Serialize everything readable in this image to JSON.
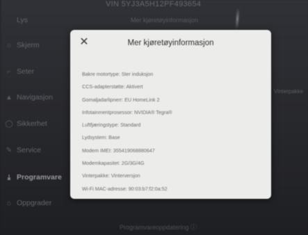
{
  "header": {
    "vin": "VIN 5YJ3A5H12PF493654",
    "subtitle": "Mer kjøretøyinformasjon"
  },
  "sidebar": {
    "items": [
      {
        "label": "Lys",
        "icon": "light-icon",
        "glyph": ""
      },
      {
        "label": "Skjerm",
        "icon": "display-icon",
        "glyph": "☼"
      },
      {
        "label": "Seter",
        "icon": "seat-icon",
        "glyph": "⌐"
      },
      {
        "label": "Navigasjon",
        "icon": "navigation-icon",
        "glyph": "▲"
      },
      {
        "label": "Sikkerhet",
        "icon": "shield-icon",
        "glyph": "◯"
      },
      {
        "label": "Service",
        "icon": "wrench-icon",
        "glyph": "✎"
      },
      {
        "label": "Programvare",
        "icon": "download-icon",
        "glyph": "⤓"
      },
      {
        "label": "Oppgrader",
        "icon": "upgrade-icon",
        "glyph": "⌂"
      }
    ]
  },
  "right_edge": {
    "text1": "Vinterpakke",
    "text2": ""
  },
  "bottom": {
    "text": "Programvareoppdatering ⓘ"
  },
  "dialog": {
    "title": "Mer kjøretøyinformasjon",
    "close_glyph": "✕",
    "rows": [
      "Bakre motortype: Ster induksjon",
      "CCS-adapterstøtte: Aktivert",
      "Gomaljadarlipnerr: EU HomeLink 2",
      "Infotainmentprosessor: NVIDIA® Tegra®",
      "Luftfjæringstype: Standard",
      "Lydsystem: Base",
      "Modem IMEI: 355419068880647",
      "Modemkapasitet: 2G/3G/4G",
      "Vinterpakke: Vinterversjon",
      "Wi-Fi MAC-adresse: 90:03:b7:f2:0a:52"
    ]
  }
}
